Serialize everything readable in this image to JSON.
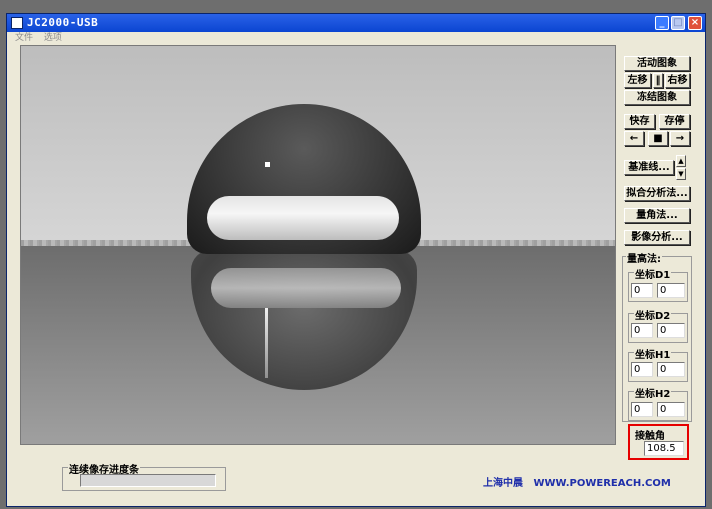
{
  "window": {
    "title": "JC2000-USB",
    "min_label": "_",
    "max_label": "□",
    "close_label": "×"
  },
  "menu": [
    "文件",
    "选项"
  ],
  "buttons": {
    "live_image": "活动图象",
    "left_shift": "左移",
    "pause_mark": "‖",
    "right_shift": "右移",
    "freeze_image": "冻结图象",
    "quick_save": "快存",
    "save_stop": "存停",
    "prev": "←",
    "stop": "■",
    "next": "→",
    "baseline": "基准线...",
    "spin_up": "▲",
    "spin_down": "▼",
    "fit_analysis": "拟合分析法...",
    "angle_method": "量角法...",
    "image_analysis": "影像分析..."
  },
  "height_method": {
    "label": "量高法:",
    "d1": {
      "label": "坐标D1",
      "x": "0",
      "y": "0"
    },
    "d2": {
      "label": "坐标D2",
      "x": "0",
      "y": "0"
    },
    "h1": {
      "label": "坐标H1",
      "x": "0",
      "y": "0"
    },
    "h2": {
      "label": "坐标H2",
      "x": "0",
      "y": "0"
    }
  },
  "contact_angle": {
    "label": "接触角",
    "value": "108.5"
  },
  "progress": {
    "label": "连续像存进度条",
    "value": 0
  },
  "footer": {
    "company": "上海中晨",
    "url": "WWW.POWEREACH.COM"
  },
  "colors": {
    "title_bar": "#0b45d1",
    "highlight_border": "#e60000",
    "footer_text": "#1f2faa"
  }
}
